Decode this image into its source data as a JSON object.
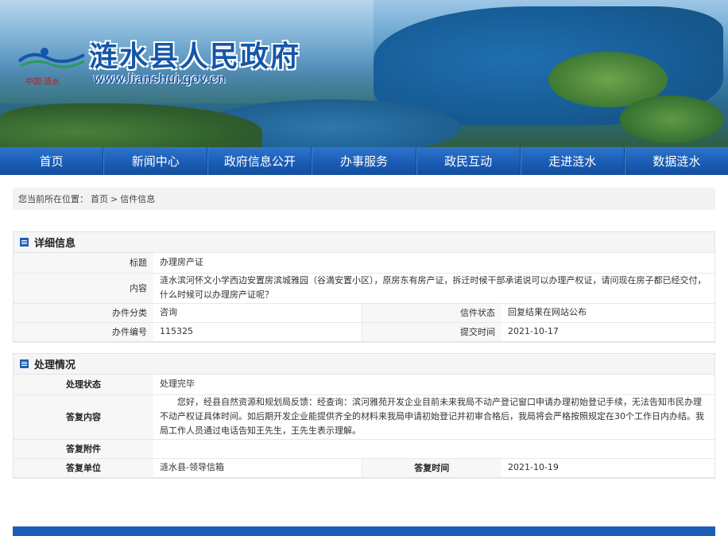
{
  "header": {
    "site_title": "涟水县人民政府",
    "site_url": "www.lianshui.gov.cn",
    "sub_logo": "中国·涟水"
  },
  "nav": {
    "items": [
      "首页",
      "新闻中心",
      "政府信息公开",
      "办事服务",
      "政民互动",
      "走进涟水",
      "数据涟水"
    ]
  },
  "breadcrumb": {
    "prefix": "您当前所在位置：",
    "home": "首页",
    "sep": ">",
    "current": "信件信息"
  },
  "detail": {
    "heading": "详细信息",
    "title_label": "标题",
    "title_value": "办理房产证",
    "content_label": "内容",
    "content_value": "涟水滨河怀文小学西边安置房滨城雅园（谷満安置小区），原房东有房产证，拆迁时候干部承诺说可以办理产权证，请问现在房子都已经交付，什么时候可以办理房产证呢？",
    "category_label": "办件分类",
    "category_value": "咨询",
    "status_label": "信件状态",
    "status_value": "回复结果在网站公布",
    "number_label": "办件编号",
    "number_value": "115325",
    "submit_label": "提交时间",
    "submit_value": "2021-10-17"
  },
  "handling": {
    "heading": "处理情况",
    "state_label": "处理状态",
    "state_value": "处理完毕",
    "reply_label": "答复内容",
    "reply_value": "您好，经县自然资源和规划局反馈：经查询：滨河雅苑开发企业目前未来我局不动产登记窗口申请办理初始登记手续，无法告知市民办理不动产权证具体时间。如后期开发企业能提供齐全的材料来我局申请初始登记并初审合格后，我局将会严格按照规定在30个工作日内办结。我局工作人员通过电话告知王先生，王先生表示理解。",
    "attachment_label": "答复附件",
    "attachment_value": "",
    "unit_label": "答复单位",
    "unit_value": "涟水县-领导信箱",
    "time_label": "答复时间",
    "time_value": "2021-10-19"
  },
  "colors": {
    "brand_blue": "#1c5fb8",
    "title_blue": "#1556a8"
  }
}
